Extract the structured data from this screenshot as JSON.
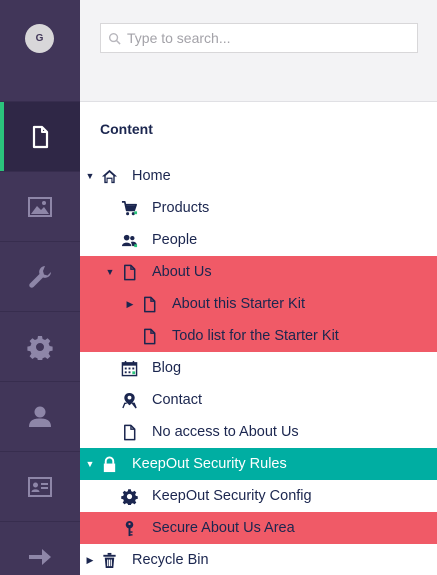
{
  "user": {
    "initial": "G"
  },
  "nav": [
    {
      "name": "content",
      "icon": "document-icon",
      "active": true
    },
    {
      "name": "media",
      "icon": "image-icon",
      "active": false
    },
    {
      "name": "settings",
      "icon": "wrench-icon",
      "active": false
    },
    {
      "name": "developer",
      "icon": "gear-icon",
      "active": false
    },
    {
      "name": "users",
      "icon": "user-icon",
      "active": false
    },
    {
      "name": "members",
      "icon": "id-card-icon",
      "active": false
    },
    {
      "name": "translation",
      "icon": "arrow-right-icon",
      "active": false
    }
  ],
  "search": {
    "placeholder": "Type to search..."
  },
  "section": {
    "title": "Content"
  },
  "tree": [
    {
      "label": "Home",
      "icon": "home-icon",
      "depth": 0,
      "caret": "expanded"
    },
    {
      "label": "Products",
      "icon": "cart-icon",
      "depth": 1,
      "caret": "none"
    },
    {
      "label": "People",
      "icon": "people-icon",
      "depth": 1,
      "caret": "none"
    },
    {
      "label": "About Us",
      "icon": "document-icon",
      "depth": 1,
      "caret": "expanded",
      "highlight": "red"
    },
    {
      "label": "About this Starter Kit",
      "icon": "document-icon",
      "depth": 2,
      "caret": "collapsed",
      "highlight": "red"
    },
    {
      "label": "Todo list for the Starter Kit",
      "icon": "document-icon",
      "depth": 2,
      "caret": "none",
      "highlight": "red"
    },
    {
      "label": "Blog",
      "icon": "calendar-icon",
      "depth": 1,
      "caret": "none"
    },
    {
      "label": "Contact",
      "icon": "map-pin-icon",
      "depth": 1,
      "caret": "none"
    },
    {
      "label": "No access to About Us",
      "icon": "document-icon",
      "depth": 1,
      "caret": "none"
    },
    {
      "label": "KeepOut Security Rules",
      "icon": "lock-icon",
      "depth": 0,
      "caret": "expanded",
      "highlight": "teal"
    },
    {
      "label": "KeepOut Security Config",
      "icon": "gear-icon",
      "depth": 1,
      "caret": "none"
    },
    {
      "label": "Secure About Us Area",
      "icon": "key-icon",
      "depth": 1,
      "caret": "none",
      "highlight": "red"
    },
    {
      "label": "Recycle Bin",
      "icon": "trash-icon",
      "depth": 0,
      "caret": "collapsed"
    }
  ],
  "colors": {
    "sidebar": "#413659",
    "active_accent": "#2bc37c",
    "highlight_red": "#f05a67",
    "highlight_teal": "#00aea2",
    "text": "#1b264f"
  }
}
